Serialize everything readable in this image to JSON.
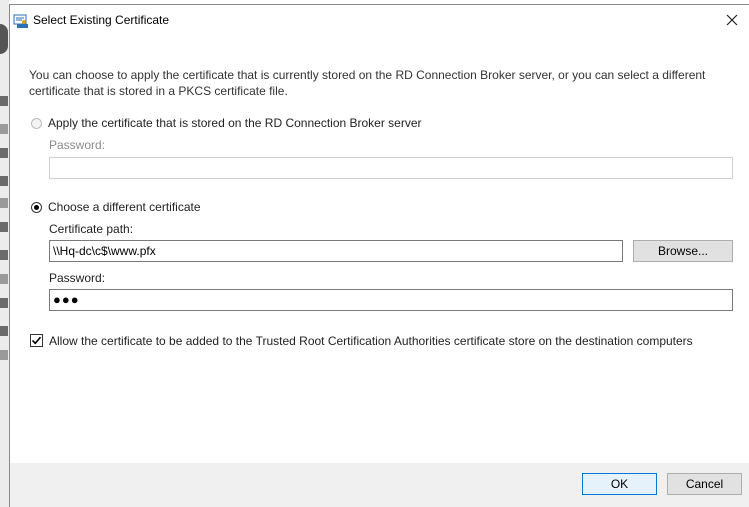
{
  "window": {
    "title": "Select Existing Certificate",
    "title_icon": "certificate-icon",
    "close_icon": "close-icon"
  },
  "description": "You can choose to apply the certificate that is currently stored on the RD Connection Broker server, or you can select a different certificate that is stored in a PKCS certificate file.",
  "option_stored": {
    "label": "Apply the certificate that is stored on the RD Connection Broker server",
    "selected": false,
    "enabled": false,
    "password_label": "Password:",
    "password_value": ""
  },
  "option_different": {
    "label": "Choose a different certificate",
    "selected": true,
    "path_label": "Certificate path:",
    "path_value": "\\\\Hq-dc\\c$\\www.pfx",
    "browse_label": "Browse...",
    "password_label": "Password:",
    "password_value": "●●●"
  },
  "trust_checkbox": {
    "label": "Allow the certificate to be added to the Trusted Root Certification Authorities certificate store on the destination computers",
    "checked": true
  },
  "footer": {
    "ok_label": "OK",
    "cancel_label": "Cancel"
  },
  "colors": {
    "footer_bg": "#f0f0f0",
    "default_button_border": "#0078d7",
    "button_bg": "#e1e1e1"
  }
}
